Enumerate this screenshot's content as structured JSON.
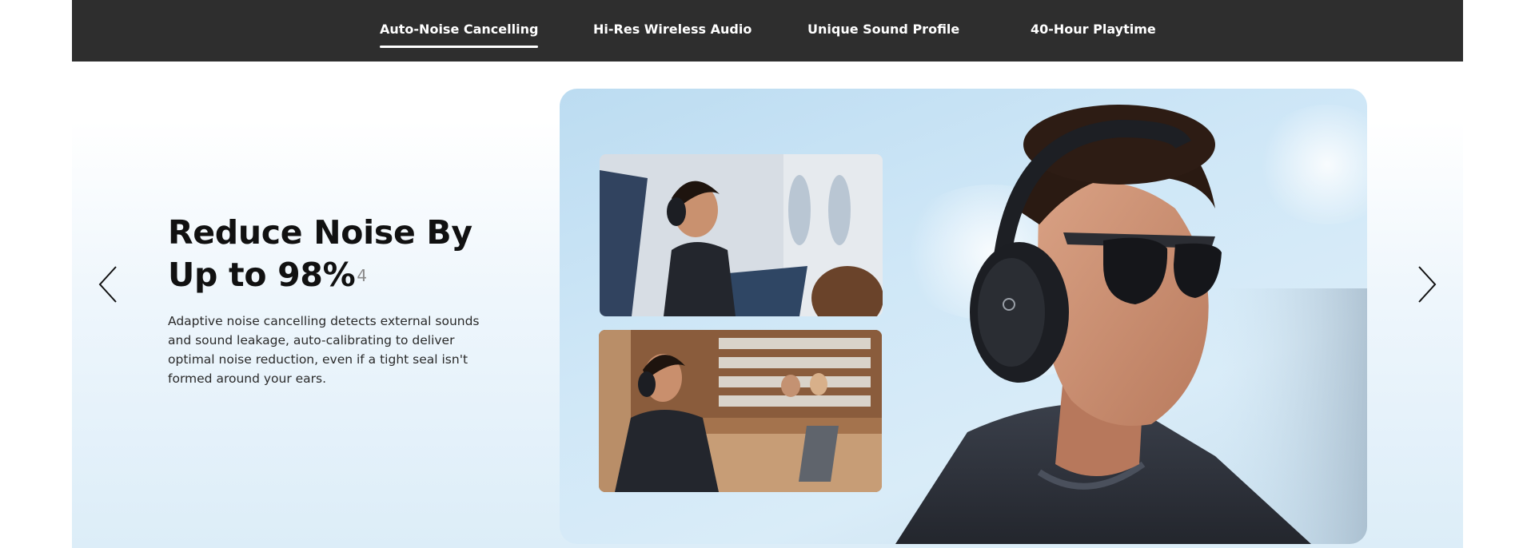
{
  "tabs": [
    {
      "label": "Auto-Noise Cancelling",
      "active": true
    },
    {
      "label": "Hi-Res Wireless Audio",
      "active": false
    },
    {
      "label": "Unique Sound Profile",
      "active": false
    },
    {
      "label": "40-Hour Playtime",
      "active": false
    }
  ],
  "feature": {
    "headline_line1": "Reduce Noise By",
    "headline_line2": "Up to 98%",
    "footnote": "4",
    "description": "Adaptive noise cancelling detects external sounds and sound leakage, auto-calibrating to deliver optimal noise reduction, even if a tight seal isn't formed around your ears."
  },
  "carousel": {
    "prev_icon": "chevron-left-icon",
    "next_icon": "chevron-right-icon"
  },
  "colors": {
    "tabbar_bg": "#2e2e2e",
    "tab_text": "#ffffff",
    "headline": "#111111",
    "hero_bg": "#cfe7f7"
  }
}
